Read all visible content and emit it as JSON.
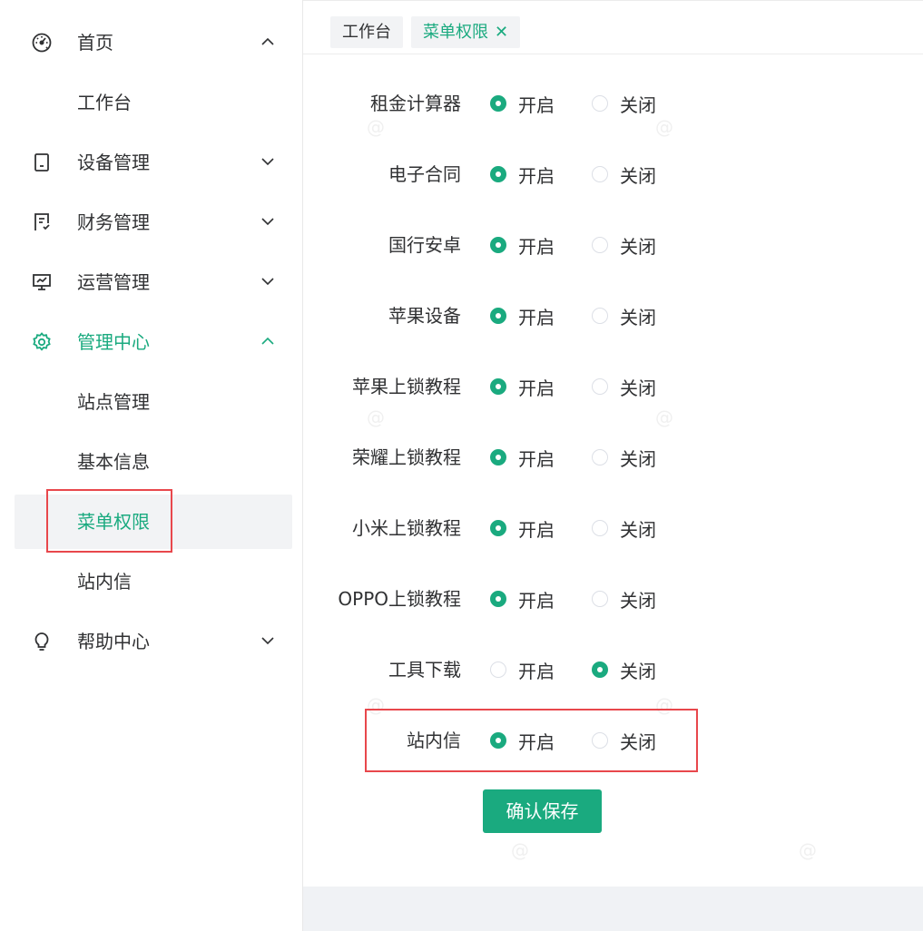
{
  "sidebar": {
    "items": [
      {
        "label": "首页",
        "icon": "dashboard-icon",
        "expanded": true
      },
      {
        "label": "工作台"
      },
      {
        "label": "设备管理",
        "icon": "device-icon",
        "expanded": false
      },
      {
        "label": "财务管理",
        "icon": "finance-icon",
        "expanded": false
      },
      {
        "label": "运营管理",
        "icon": "monitor-icon",
        "expanded": false
      },
      {
        "label": "管理中心",
        "icon": "gear-icon",
        "expanded": true
      },
      {
        "label": "站点管理"
      },
      {
        "label": "基本信息"
      },
      {
        "label": "菜单权限",
        "selected": true
      },
      {
        "label": "站内信"
      },
      {
        "label": "帮助中心",
        "icon": "bulb-icon",
        "expanded": false
      }
    ]
  },
  "tabs": [
    {
      "label": "工作台"
    },
    {
      "label": "菜单权限",
      "close": "✕"
    }
  ],
  "radio_labels": {
    "on": "开启",
    "off": "关闭"
  },
  "permissions": [
    {
      "label": "租金计算器",
      "value": "on"
    },
    {
      "label": "电子合同",
      "value": "on"
    },
    {
      "label": "国行安卓",
      "value": "on"
    },
    {
      "label": "苹果设备",
      "value": "on"
    },
    {
      "label": "苹果上锁教程",
      "value": "on"
    },
    {
      "label": "荣耀上锁教程",
      "value": "on"
    },
    {
      "label": "小米上锁教程",
      "value": "on"
    },
    {
      "label": "OPPO上锁教程",
      "value": "on"
    },
    {
      "label": "工具下载",
      "value": "off"
    },
    {
      "label": "站内信",
      "value": "on"
    }
  ],
  "save_button": "确认保存",
  "colors": {
    "accent": "#1aaa7f",
    "highlight": "#e8474c"
  }
}
